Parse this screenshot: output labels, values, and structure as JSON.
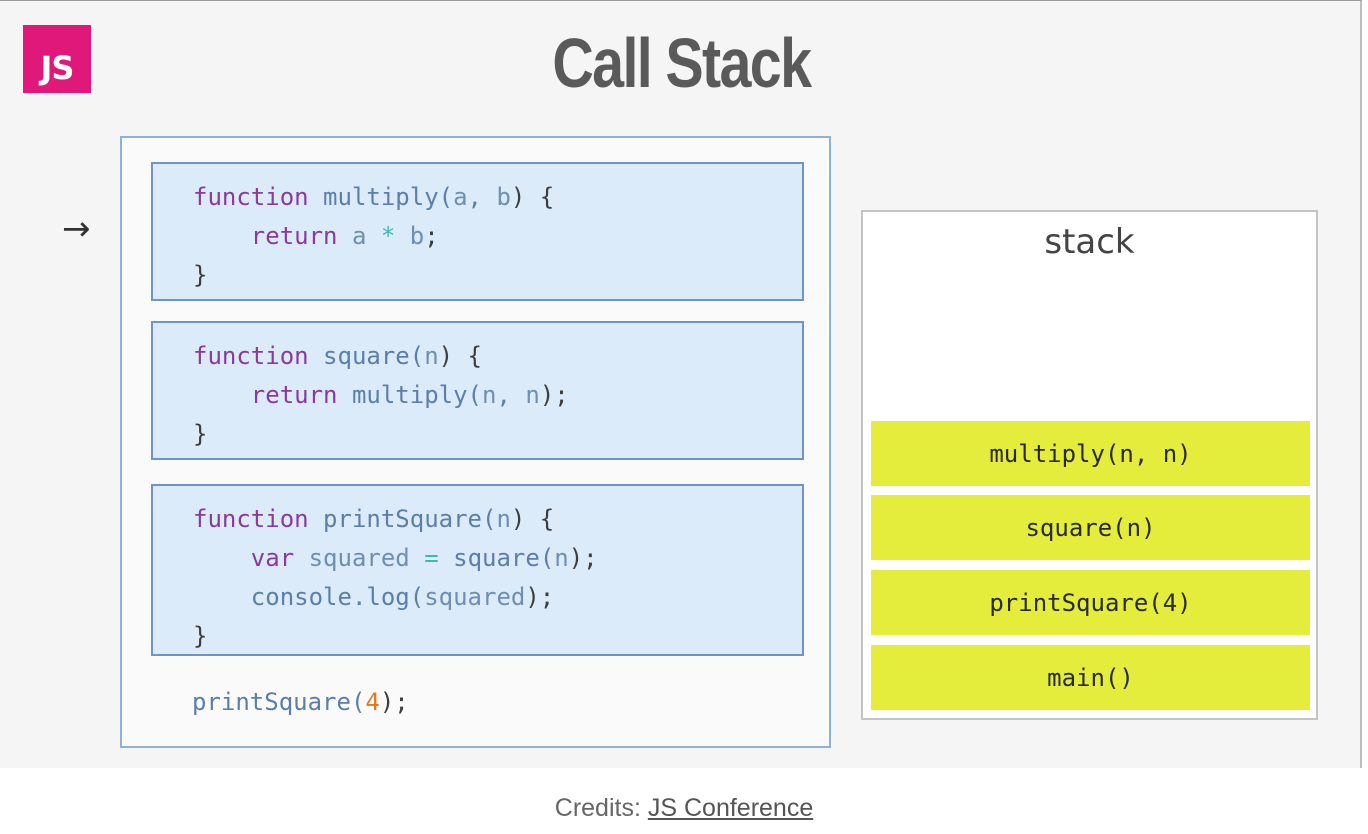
{
  "header": {
    "logo_text": "JS",
    "title": "Call Stack"
  },
  "pointer": {
    "glyph": "→"
  },
  "code": {
    "multiply": {
      "kw": "function",
      "name": "multiply",
      "open": "(",
      "p1": "a",
      "sep": ", ",
      "p2": "b",
      "close": ") {",
      "ret": "return",
      "a": "a",
      "op": "*",
      "b": "b",
      "semi": ";",
      "end": "}"
    },
    "square": {
      "kw": "function",
      "name": "square",
      "open": "(",
      "p1": "n",
      "close": ") {",
      "ret": "return",
      "call": "multiply",
      "c_open": "(",
      "a1": "n",
      "sep": ", ",
      "a2": "n",
      "c_close": ");",
      "end": "}"
    },
    "printSquare": {
      "kw": "function",
      "name": "printSquare",
      "open": "(",
      "p1": "n",
      "close": ") {",
      "var": "var",
      "varname": "squared",
      "eq": "=",
      "call": "square",
      "c_open": "(",
      "arg": "n",
      "c_close": ");",
      "console": "console.log",
      "l_open": "(",
      "l_arg": "squared",
      "l_close": ");",
      "end": "}"
    },
    "invoke": {
      "name": "printSquare",
      "open": "(",
      "arg": "4",
      "close": ");"
    }
  },
  "stack": {
    "title": "stack",
    "frames": [
      "multiply(n, n)",
      "square(n)",
      "printSquare(4)",
      "main()"
    ]
  },
  "credits": {
    "prefix": "Credits: ",
    "link": "JS Conference"
  },
  "colors": {
    "keyword": "#8b3a9c",
    "identifier": "#5b7fa8",
    "operator": "#3fb8b0",
    "number": "#e07a22",
    "frame": "#e4ec3c",
    "code_box": "#dcebf9",
    "logo": "#e0187a"
  }
}
